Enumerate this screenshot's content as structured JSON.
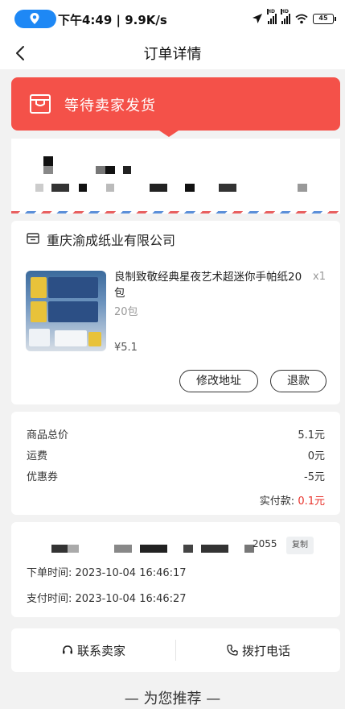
{
  "status_bar": {
    "time_speed": "下午4:49 | 9.9K/s",
    "battery": "45",
    "signal_label": "HD"
  },
  "nav": {
    "title": "订单详情"
  },
  "banner": {
    "status_text": "等待卖家发货",
    "color": "#f45149"
  },
  "store": {
    "name": "重庆渝成纸业有限公司"
  },
  "product": {
    "title": "良制致敬经典星夜艺术超迷你手帕纸20包",
    "quantity": "x1",
    "spec": "20包",
    "price": "¥5.1"
  },
  "actions": {
    "modify_address": "修改地址",
    "refund": "退款"
  },
  "price_summary": {
    "rows": [
      {
        "label": "商品总价",
        "value": "5.1元"
      },
      {
        "label": "运费",
        "value": "0元"
      },
      {
        "label": "优惠券",
        "value": "-5元"
      }
    ],
    "paid_label": "实付款:",
    "paid_amount": "0.1元",
    "accent": "#e8312a"
  },
  "order_info": {
    "order_no_tail": "2055",
    "copy_label": "复制",
    "placed_time": "下单时间: 2023-10-04 16:46:17",
    "paid_time": "支付时间: 2023-10-04 16:46:27"
  },
  "contact": {
    "seller": "联系卖家",
    "phone": "拨打电话"
  },
  "recommend": {
    "title": "— 为您推荐 —"
  }
}
